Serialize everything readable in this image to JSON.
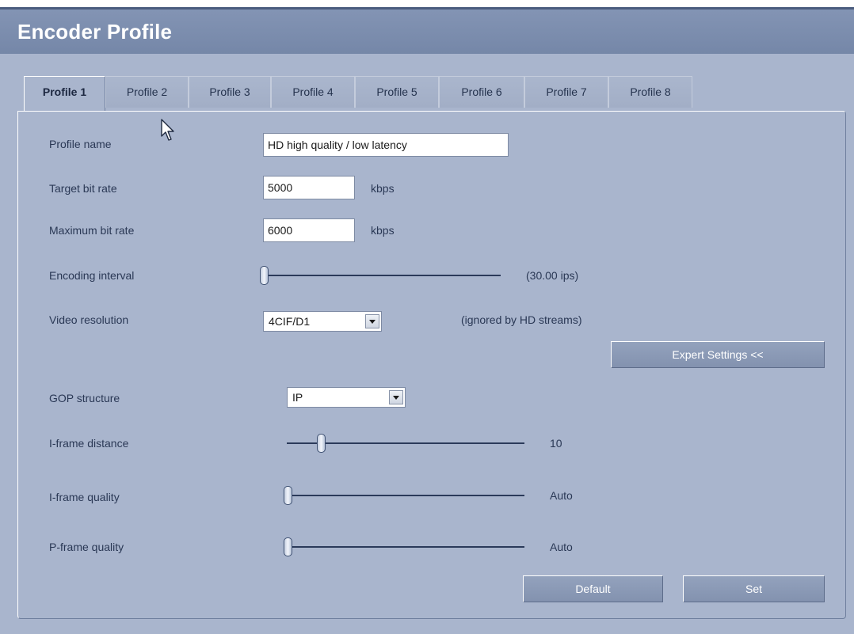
{
  "header": {
    "title": "Encoder Profile"
  },
  "tabs": [
    {
      "label": "Profile 1"
    },
    {
      "label": "Profile 2"
    },
    {
      "label": "Profile 3"
    },
    {
      "label": "Profile 4"
    },
    {
      "label": "Profile 5"
    },
    {
      "label": "Profile 6"
    },
    {
      "label": "Profile 7"
    },
    {
      "label": "Profile 8"
    }
  ],
  "active_tab": "Profile 1",
  "form": {
    "profile_name": {
      "label": "Profile name",
      "value": "HD high quality / low latency"
    },
    "target_bit_rate": {
      "label": "Target bit rate",
      "value": "5000",
      "unit": "kbps"
    },
    "maximum_bit_rate": {
      "label": "Maximum bit rate",
      "value": "6000",
      "unit": "kbps"
    },
    "encoding_interval": {
      "label": "Encoding interval",
      "readout": "(30.00 ips)",
      "position": 0
    },
    "video_resolution": {
      "label": "Video resolution",
      "value": "4CIF/D1",
      "note": "(ignored by HD streams)"
    },
    "expert_button": "Expert Settings <<",
    "gop_structure": {
      "label": "GOP structure",
      "value": "IP"
    },
    "iframe_distance": {
      "label": "I-frame distance",
      "readout": "10",
      "position": 0.13
    },
    "iframe_quality": {
      "label": "I-frame quality",
      "readout": "Auto",
      "position": 0
    },
    "pframe_quality": {
      "label": "P-frame quality",
      "readout": "Auto",
      "position": 0
    }
  },
  "buttons": {
    "default": "Default",
    "set": "Set"
  },
  "colors": {
    "background": "#a9b5cd",
    "header": "#7a8cad",
    "button": "#8a98b4"
  },
  "icons": [
    "mouse-pointer-icon",
    "dropdown-arrow-icon"
  ]
}
